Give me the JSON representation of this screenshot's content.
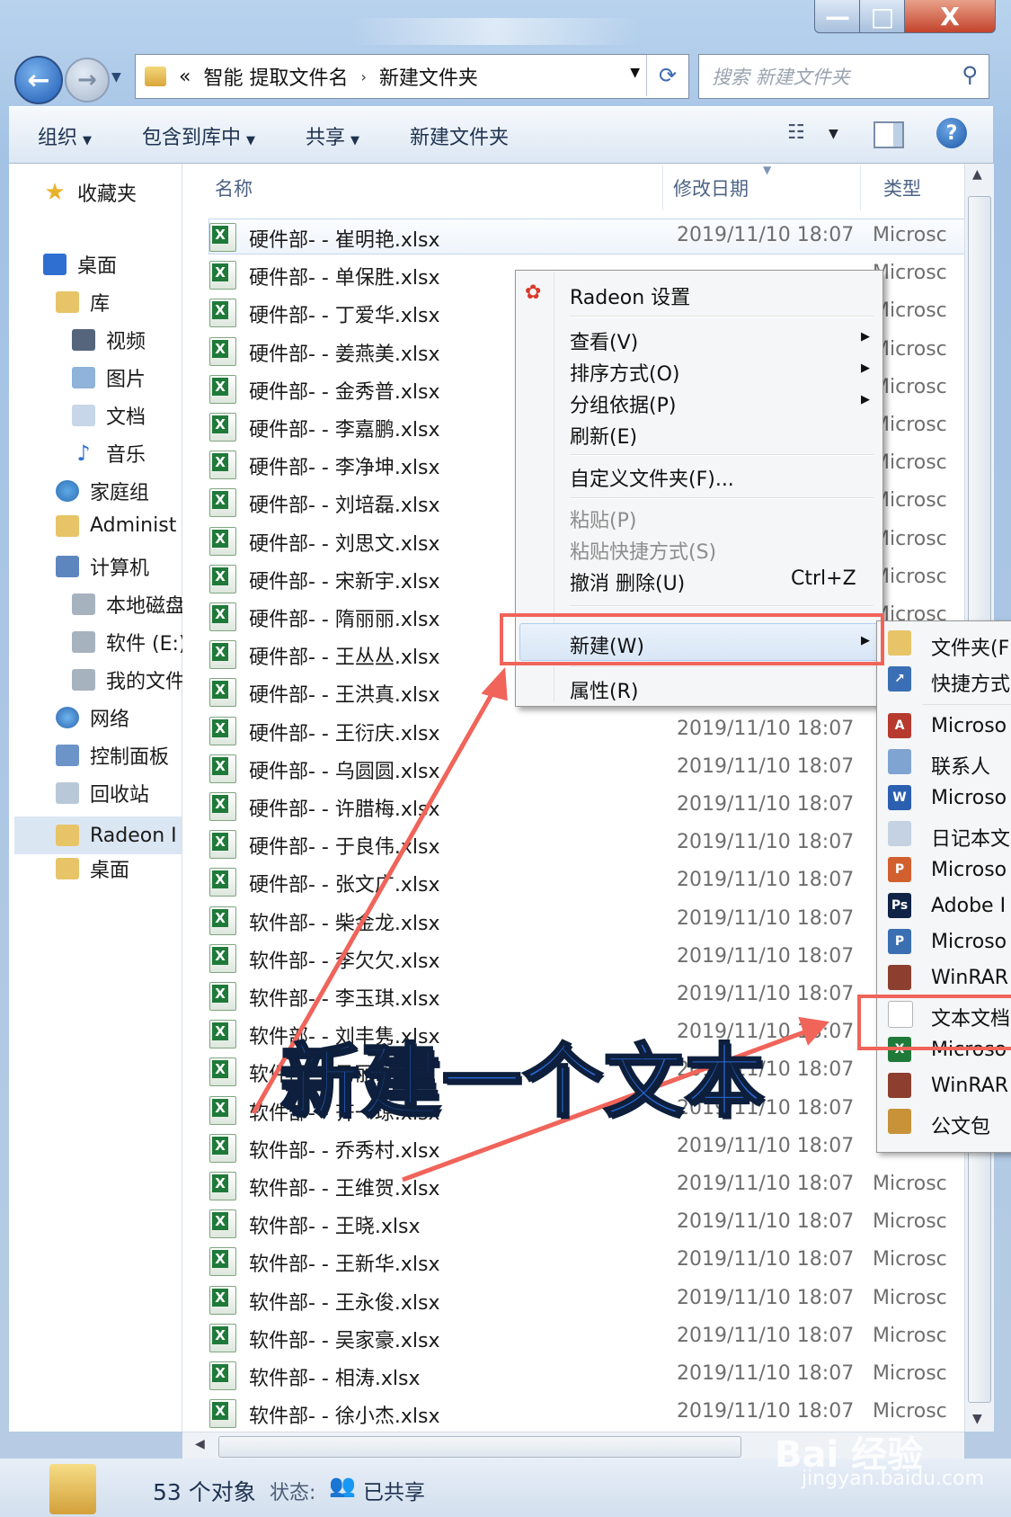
{
  "window": {
    "minimize_glyph": "—",
    "maximize_glyph": "□",
    "close_glyph": "X"
  },
  "nav": {
    "back_glyph": "←",
    "forward_glyph": "→",
    "address": {
      "prefix": "«",
      "crumbs": [
        "智能 提取文件名",
        "新建文件夹"
      ],
      "separator": "›"
    },
    "search_placeholder": "搜索 新建文件夹"
  },
  "toolbar": {
    "organize": "组织",
    "include_library": "包含到库中",
    "share": "共享",
    "new_folder": "新建文件夹"
  },
  "sidebar": {
    "items": [
      {
        "label": "收藏夹",
        "icon": "star-icon"
      },
      {
        "label": "桌面",
        "icon": "desktop-icon"
      },
      {
        "label": "库",
        "icon": "library-icon"
      },
      {
        "label": "视频",
        "icon": "video-icon"
      },
      {
        "label": "图片",
        "icon": "pictures-icon"
      },
      {
        "label": "文档",
        "icon": "documents-icon"
      },
      {
        "label": "音乐",
        "icon": "music-icon"
      },
      {
        "label": "家庭组",
        "icon": "homegroup-icon"
      },
      {
        "label": "Administ",
        "icon": "user-folder-icon"
      },
      {
        "label": "计算机",
        "icon": "computer-icon"
      },
      {
        "label": "本地磁盘",
        "icon": "disk-icon"
      },
      {
        "label": "软件 (E:)",
        "icon": "disk-icon"
      },
      {
        "label": "我的文件",
        "icon": "disk-icon"
      },
      {
        "label": "网络",
        "icon": "network-icon"
      },
      {
        "label": "控制面板",
        "icon": "control-panel-icon"
      },
      {
        "label": "回收站",
        "icon": "recycle-bin-icon"
      },
      {
        "label": "Radeon I",
        "icon": "folder-icon"
      },
      {
        "label": "桌面",
        "icon": "folder-icon"
      }
    ]
  },
  "columns": {
    "name": "名称",
    "date": "修改日期",
    "type": "类型"
  },
  "files": [
    {
      "name": "硬件部- - 崔明艳.xlsx",
      "date": "2019/11/10 18:07",
      "type": "Microsc"
    },
    {
      "name": "硬件部- - 单保胜.xlsx",
      "date": "",
      "type": "Microsc"
    },
    {
      "name": "硬件部- - 丁爱华.xlsx",
      "date": "",
      "type": "Microsc"
    },
    {
      "name": "硬件部- - 姜燕美.xlsx",
      "date": "",
      "type": "Microsc"
    },
    {
      "name": "硬件部- - 金秀普.xlsx",
      "date": "",
      "type": "Microsc"
    },
    {
      "name": "硬件部- - 李嘉鹏.xlsx",
      "date": "",
      "type": "Microsc"
    },
    {
      "name": "硬件部- - 李净坤.xlsx",
      "date": "",
      "type": "Microsc"
    },
    {
      "name": "硬件部- - 刘培磊.xlsx",
      "date": "",
      "type": "Microsc"
    },
    {
      "name": "硬件部- - 刘思文.xlsx",
      "date": "",
      "type": "Microsc"
    },
    {
      "name": "硬件部- - 宋新宇.xlsx",
      "date": "",
      "type": "Microsc"
    },
    {
      "name": "硬件部- - 隋丽丽.xlsx",
      "date": "",
      "type": "Microsc"
    },
    {
      "name": "硬件部- - 王丛丛.xlsx",
      "date": "",
      "type": ""
    },
    {
      "name": "硬件部- - 王洪真.xlsx",
      "date": "",
      "type": ""
    },
    {
      "name": "硬件部- - 王衍庆.xlsx",
      "date": "2019/11/10 18:07",
      "type": ""
    },
    {
      "name": "硬件部- - 乌圆圆.xlsx",
      "date": "2019/11/10 18:07",
      "type": ""
    },
    {
      "name": "硬件部- - 许腊梅.xlsx",
      "date": "2019/11/10 18:07",
      "type": ""
    },
    {
      "name": "硬件部- - 于良伟.xlsx",
      "date": "2019/11/10 18:07",
      "type": ""
    },
    {
      "name": "硬件部- - 张文广.xlsx",
      "date": "2019/11/10 18:07",
      "type": ""
    },
    {
      "name": "软件部- - 柴金龙.xlsx",
      "date": "2019/11/10 18:07",
      "type": ""
    },
    {
      "name": "软件部- - 李欠欠.xlsx",
      "date": "2019/11/10 18:07",
      "type": ""
    },
    {
      "name": "软件部- - 李玉琪.xlsx",
      "date": "2019/11/10 18:07",
      "type": ""
    },
    {
      "name": "软件部- - 刘丰隽.xlsx",
      "date": "2019/11/10 18:07",
      "type": ""
    },
    {
      "name": "软件部- - 马丽.xlsx",
      "date": "2019/11/10 18:07",
      "type": ""
    },
    {
      "name": "软件部- - 齐一琼.xlsx",
      "date": "2019/11/10 18:07",
      "type": ""
    },
    {
      "name": "软件部- - 乔秀村.xlsx",
      "date": "2019/11/10 18:07",
      "type": ""
    },
    {
      "name": "软件部- - 王维贺.xlsx",
      "date": "2019/11/10 18:07",
      "type": "Microsc"
    },
    {
      "name": "软件部- - 王晓.xlsx",
      "date": "2019/11/10 18:07",
      "type": "Microsc"
    },
    {
      "name": "软件部- - 王新华.xlsx",
      "date": "2019/11/10 18:07",
      "type": "Microsc"
    },
    {
      "name": "软件部- - 王永俊.xlsx",
      "date": "2019/11/10 18:07",
      "type": "Microsc"
    },
    {
      "name": "软件部- - 吴家豪.xlsx",
      "date": "2019/11/10 18:07",
      "type": "Microsc"
    },
    {
      "name": "软件部- - 相涛.xlsx",
      "date": "2019/11/10 18:07",
      "type": "Microsc"
    },
    {
      "name": "软件部- - 徐小杰.xlsx",
      "date": "2019/11/10 18:07",
      "type": "Microsc"
    }
  ],
  "context_menu": {
    "radeon": "Radeon 设置",
    "view": "查看(V)",
    "sort": "排序方式(O)",
    "group": "分组依据(P)",
    "refresh": "刷新(E)",
    "customize": "自定义文件夹(F)...",
    "paste": "粘贴(P)",
    "paste_shortcut": "粘贴快捷方式(S)",
    "undo": "撤消 删除(U)",
    "undo_shortcut": "Ctrl+Z",
    "new": "新建(W)",
    "properties": "属性(R)"
  },
  "submenu": {
    "items": [
      "文件夹(F",
      "快捷方式",
      "Microso",
      "联系人",
      "Microso",
      "日记本文",
      "Microso",
      "Adobe I",
      "Microso",
      "WinRAR",
      "文本文档",
      "Microso",
      "WinRAR",
      "公文包"
    ]
  },
  "status": {
    "count": "53 个对象",
    "state_label": "状态:",
    "state_value": "已共享"
  },
  "annotation": {
    "caption": "新建一个文本",
    "color": "#f0645a"
  },
  "watermark": {
    "brand": "Bai 经验",
    "url": "jingyan.baidu.com"
  }
}
